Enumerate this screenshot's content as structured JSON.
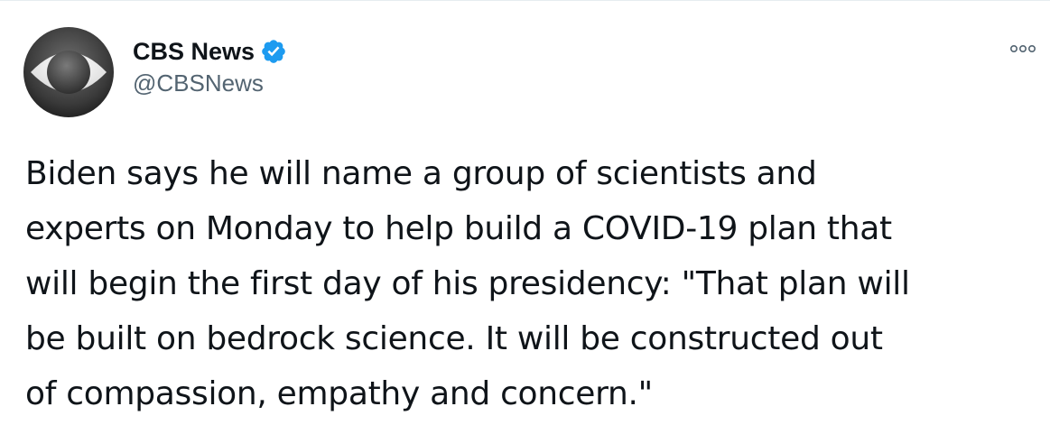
{
  "tweet": {
    "author": {
      "display_name": "CBS News",
      "handle": "@CBSNews",
      "verified": true,
      "avatar_icon": "cbs-eye-logo-icon"
    },
    "more_icon": "more-options-icon",
    "text_lines": [
      "Biden says he will name a group of scientists and",
      "experts on Monday to help build a COVID-19 plan that",
      "will begin the first day of his presidency: \"That plan will",
      "be built on bedrock science. It will be constructed out",
      "of compassion, empathy and concern.\""
    ]
  },
  "colors": {
    "verified_badge": "#1d9bf0",
    "handle_text": "#536471",
    "text": "#0f1419"
  }
}
